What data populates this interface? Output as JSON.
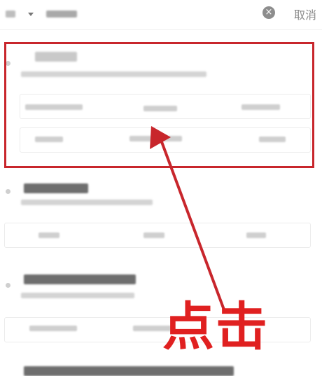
{
  "search_bar": {
    "cancel_label": "取消",
    "clear_icon": "×",
    "icons": [
      "caret-down-icon",
      "clear-icon"
    ]
  },
  "annotation": {
    "label": "点击",
    "color": "#e02020",
    "highlight_color": "#c8262c"
  }
}
